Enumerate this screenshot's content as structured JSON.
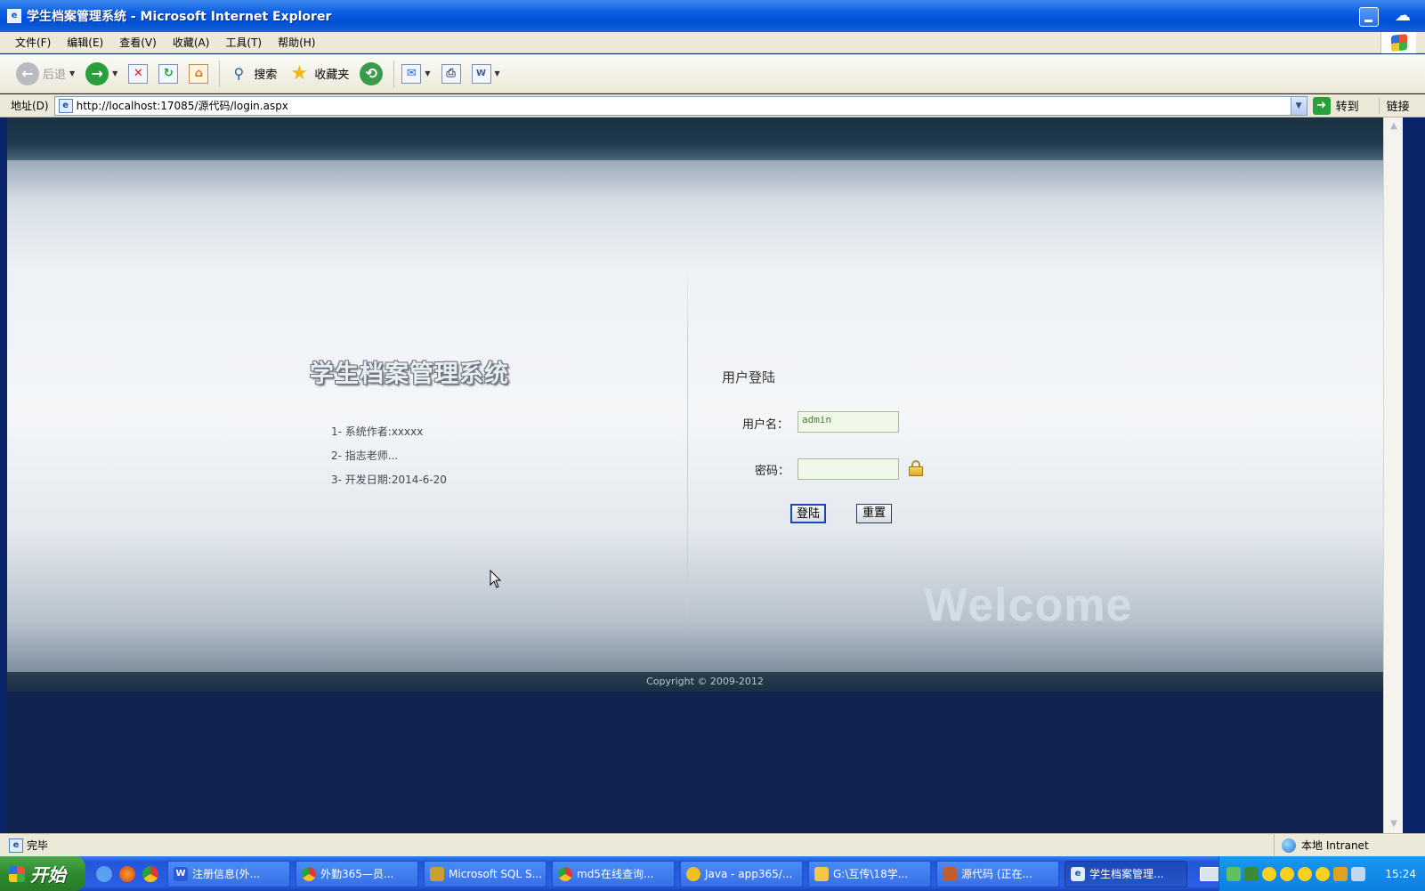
{
  "window": {
    "title": "学生档案管理系统 - Microsoft Internet Explorer"
  },
  "menu": [
    {
      "label": "文件(F)"
    },
    {
      "label": "编辑(E)"
    },
    {
      "label": "查看(V)"
    },
    {
      "label": "收藏(A)"
    },
    {
      "label": "工具(T)"
    },
    {
      "label": "帮助(H)"
    }
  ],
  "toolbar": {
    "back_label": "后退",
    "search_label": "搜索",
    "favorites_label": "收藏夹"
  },
  "address": {
    "label": "地址(D)",
    "url": "http://localhost:17085/源代码/login.aspx",
    "go_label": "转到",
    "links_label": "链接"
  },
  "page": {
    "system_title": "学生档案管理系统",
    "info": [
      "1- 系统作者:xxxxx",
      "2- 指志老师...",
      "3- 开发日期:2014-6-20"
    ],
    "login_title": "用户登陆",
    "username_label": "用户名：",
    "username_value": "admin",
    "password_label": "密码：",
    "login_button": "登陆",
    "reset_button": "重置",
    "welcome": "Welcome",
    "copyright": "Copyright © 2009-2012"
  },
  "status": {
    "text": "完毕",
    "zone": "本地 Intranet"
  },
  "taskbar": {
    "start_label": "开始",
    "tasks": [
      {
        "label": "注册信息(外...",
        "icon_color": "#2a5ad8"
      },
      {
        "label": "外勤365—员...",
        "icon_color": "#e04030"
      },
      {
        "label": "Microsoft SQL S...",
        "icon_color": "#c8a030"
      },
      {
        "label": "md5在线查询...",
        "icon_color": "#e04030"
      },
      {
        "label": "Java - app365/...",
        "icon_color": "#f0c020"
      },
      {
        "label": "G:\\互传\\18学...",
        "icon_color": "#f0c848"
      },
      {
        "label": "源代码 (正在...",
        "icon_color": "#c06030"
      },
      {
        "label": "学生档案管理...",
        "icon_color": "#4080e0"
      }
    ],
    "clock": "15:24"
  }
}
